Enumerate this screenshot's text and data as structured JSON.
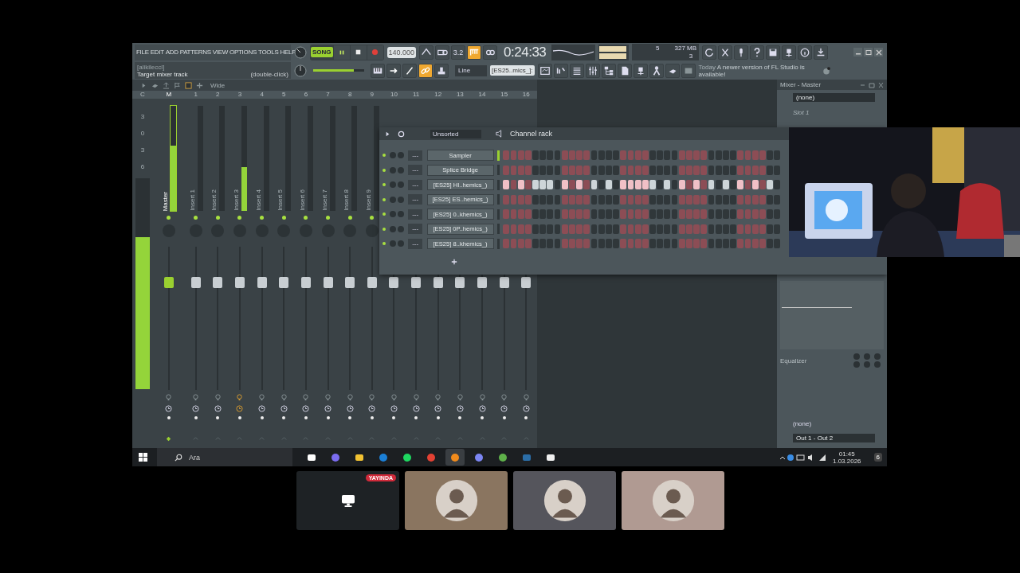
{
  "menu": [
    "FILE",
    "EDIT",
    "ADD",
    "PATTERNS",
    "VIEW",
    "OPTIONS",
    "TOOLS",
    "HELP"
  ],
  "hint": {
    "project": "[alikilecci]",
    "message": "Target mixer track",
    "action": "(double-click)"
  },
  "transport": {
    "mode": "SONG",
    "tempo": "140.000",
    "time": "0:24:33"
  },
  "record_buttons": [
    {
      "on": false
    },
    {
      "on": false
    },
    {
      "on": false,
      "label": "3.2"
    },
    {
      "on": true
    },
    {
      "on": false
    }
  ],
  "resources": {
    "polyphony": "5",
    "memory": "327 MB",
    "cpu": "3"
  },
  "master_volume": {
    "level": 0.8
  },
  "tool_buttons": [
    {
      "on": false
    },
    {
      "on": false
    },
    {
      "on": false
    },
    {
      "on": true
    },
    {
      "on": false
    }
  ],
  "snap": "Line",
  "pattern": "[ES25..mics_]:",
  "news": {
    "date": "Today",
    "message": "A newer version of FL Studio is available!"
  },
  "mixer": {
    "view": "Wide",
    "columns": [
      "C",
      "M",
      "1",
      "2",
      "3",
      "4",
      "5",
      "6",
      "7",
      "8",
      "9",
      "10",
      "11",
      "12",
      "13",
      "14",
      "15",
      "16"
    ],
    "scale": [
      "3",
      "0",
      "3",
      "6"
    ],
    "peak": {
      "level": 0.72
    },
    "tracks": [
      {
        "name": "Master",
        "level": 0.62,
        "selected": true,
        "routed": false
      },
      {
        "name": "Insert 1",
        "level": 0,
        "selected": false,
        "routed": false
      },
      {
        "name": "Insert 2",
        "level": 0,
        "selected": false,
        "routed": false
      },
      {
        "name": "Insert 3",
        "level": 0.42,
        "selected": false,
        "routed": true
      },
      {
        "name": "Insert 4",
        "level": 0,
        "selected": false,
        "routed": false
      },
      {
        "name": "Insert 5",
        "level": 0,
        "selected": false,
        "routed": false
      },
      {
        "name": "Insert 6",
        "level": 0,
        "selected": false,
        "routed": false
      },
      {
        "name": "Insert 7",
        "level": 0,
        "selected": false,
        "routed": false
      },
      {
        "name": "Insert 8",
        "level": 0,
        "selected": false,
        "routed": false
      },
      {
        "name": "Insert 9",
        "level": 0,
        "selected": false,
        "routed": false
      },
      {
        "selected": false,
        "routed": false
      },
      {
        "selected": false,
        "routed": false
      },
      {
        "selected": false,
        "routed": false
      },
      {
        "selected": false,
        "routed": false
      },
      {
        "selected": false,
        "routed": false
      },
      {
        "selected": false,
        "routed": false
      },
      {
        "selected": false,
        "routed": false
      }
    ]
  },
  "mixer_panel": {
    "title": "Mixer - Master",
    "plugin": "(none)",
    "slot": "Slot 1",
    "effect": "Equalizer",
    "input": "(none)",
    "output": "Out 1 - Out 2"
  },
  "channel_rack": {
    "title": "Channel rack",
    "group": "Unsorted",
    "channels": [
      {
        "name": "Sampler",
        "track": "---",
        "selected": true,
        "steps": [
          false,
          false,
          false,
          false,
          false,
          false,
          false,
          false,
          false,
          false,
          false,
          false,
          false,
          false,
          false,
          false,
          false,
          false,
          false,
          false,
          false,
          false,
          false,
          false,
          false,
          false,
          false,
          false,
          false,
          false,
          false,
          false,
          false,
          false,
          false,
          false,
          false,
          false
        ]
      },
      {
        "name": "Splice Bridge",
        "track": "---",
        "selected": false,
        "steps": [
          false,
          false,
          false,
          false,
          false,
          false,
          false,
          false,
          false,
          false,
          false,
          false,
          false,
          false,
          false,
          false,
          false,
          false,
          false,
          false,
          false,
          false,
          false,
          false,
          false,
          false,
          false,
          false,
          false,
          false,
          false,
          false,
          false,
          false,
          false,
          false,
          false,
          false
        ]
      },
      {
        "name": "[ES25] HI..hemics_)",
        "track": "---",
        "selected": false,
        "steps": [
          true,
          false,
          true,
          false,
          true,
          true,
          true,
          false,
          true,
          false,
          true,
          false,
          true,
          false,
          true,
          false,
          true,
          true,
          true,
          true,
          true,
          false,
          true,
          false,
          true,
          false,
          true,
          false,
          true,
          false,
          true,
          false,
          true,
          false,
          true,
          false,
          true,
          false
        ]
      },
      {
        "name": "[ES25] ES..hemics_)",
        "track": "---",
        "selected": false,
        "steps": [
          false,
          false,
          false,
          false,
          false,
          false,
          false,
          false,
          false,
          false,
          false,
          false,
          false,
          false,
          false,
          false,
          false,
          false,
          false,
          false,
          false,
          false,
          false,
          false,
          false,
          false,
          false,
          false,
          false,
          false,
          false,
          false,
          false,
          false,
          false,
          false,
          false,
          false
        ]
      },
      {
        "name": "[ES25] 0..khemics_)",
        "track": "---",
        "selected": false,
        "steps": [
          false,
          false,
          false,
          false,
          false,
          false,
          false,
          false,
          false,
          false,
          false,
          false,
          false,
          false,
          false,
          false,
          false,
          false,
          false,
          false,
          false,
          false,
          false,
          false,
          false,
          false,
          false,
          false,
          false,
          false,
          false,
          false,
          false,
          false,
          false,
          false,
          false,
          false
        ]
      },
      {
        "name": "[ES25] 0P..hemics_)",
        "track": "---",
        "selected": false,
        "steps": [
          false,
          false,
          false,
          false,
          false,
          false,
          false,
          false,
          false,
          false,
          false,
          false,
          false,
          false,
          false,
          false,
          false,
          false,
          false,
          false,
          false,
          false,
          false,
          false,
          false,
          false,
          false,
          false,
          false,
          false,
          false,
          false,
          false,
          false,
          false,
          false,
          false,
          false
        ]
      },
      {
        "name": "[ES25] 8..khemics_)",
        "track": "---",
        "selected": false,
        "steps": [
          false,
          false,
          false,
          false,
          false,
          false,
          false,
          false,
          false,
          false,
          false,
          false,
          false,
          false,
          false,
          false,
          false,
          false,
          false,
          false,
          false,
          false,
          false,
          false,
          false,
          false,
          false,
          false,
          false,
          false,
          false,
          false,
          false,
          false,
          false,
          false,
          false,
          false
        ]
      }
    ]
  },
  "taskbar": {
    "search": "Ara",
    "time": "01:45",
    "date": "1.03.2026",
    "notifications": "6",
    "apps": [
      {
        "active": false
      },
      {
        "active": false
      },
      {
        "active": false
      },
      {
        "active": false
      },
      {
        "active": false
      },
      {
        "active": false
      },
      {
        "active": true
      },
      {
        "active": false
      },
      {
        "active": false
      },
      {
        "active": false
      },
      {
        "active": false
      }
    ]
  },
  "call": {
    "tiles": [
      {
        "kind": "screen",
        "badge": "YAYINDA"
      },
      {
        "kind": "avatar",
        "color": "#8a7560"
      },
      {
        "kind": "avatar",
        "color": "#55555c"
      },
      {
        "kind": "avatar",
        "color": "#b09a92"
      }
    ]
  }
}
